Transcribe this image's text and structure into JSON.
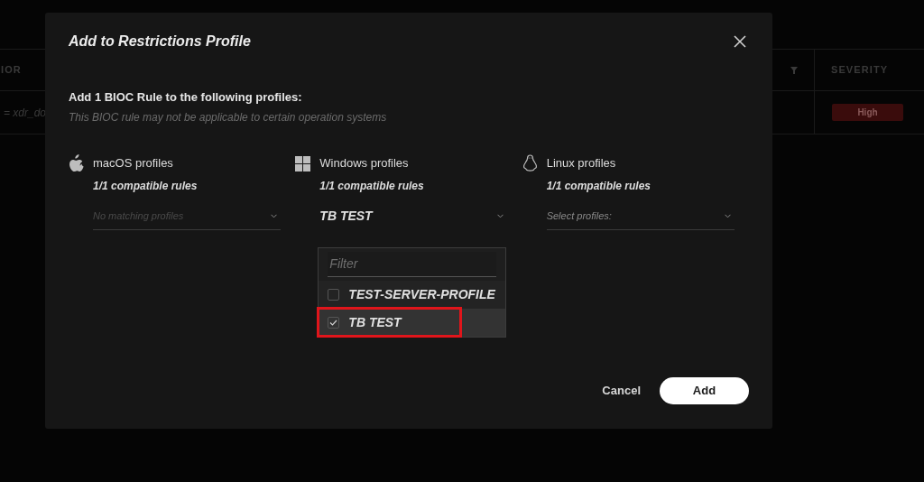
{
  "background_table": {
    "columns": [
      {
        "label": "IOR"
      },
      {
        "label": "SEVERITY"
      }
    ],
    "row": {
      "cell": "= xdr_do",
      "severity": "High"
    }
  },
  "dialog": {
    "title": "Add to Restrictions Profile",
    "heading": "Add 1 BIOC Rule to the following profiles:",
    "subtitle": "This BIOC rule may not be applicable to certain operation systems",
    "profiles": [
      {
        "kind": "apple",
        "name": "macOS profiles",
        "compat": "1/1 compatible rules",
        "select": {
          "placeholder": "No matching profiles",
          "disabled": true,
          "open": false
        }
      },
      {
        "kind": "windows",
        "name": "Windows profiles",
        "compat": "1/1 compatible rules",
        "select": {
          "value": "TB TEST",
          "disabled": false,
          "open": true,
          "filter_placeholder": "Filter",
          "options": [
            {
              "label": "TEST-SERVER-PROFILE",
              "checked": false,
              "highlighted": false
            },
            {
              "label": "TB TEST",
              "checked": true,
              "highlighted": true
            }
          ]
        }
      },
      {
        "kind": "linux",
        "name": "Linux profiles",
        "compat": "1/1 compatible rules",
        "select": {
          "placeholder": "Select profiles:",
          "disabled": false,
          "open": false
        }
      }
    ],
    "buttons": [
      {
        "kind": "text",
        "label": "Cancel"
      },
      {
        "kind": "primary",
        "label": "Add"
      }
    ]
  }
}
